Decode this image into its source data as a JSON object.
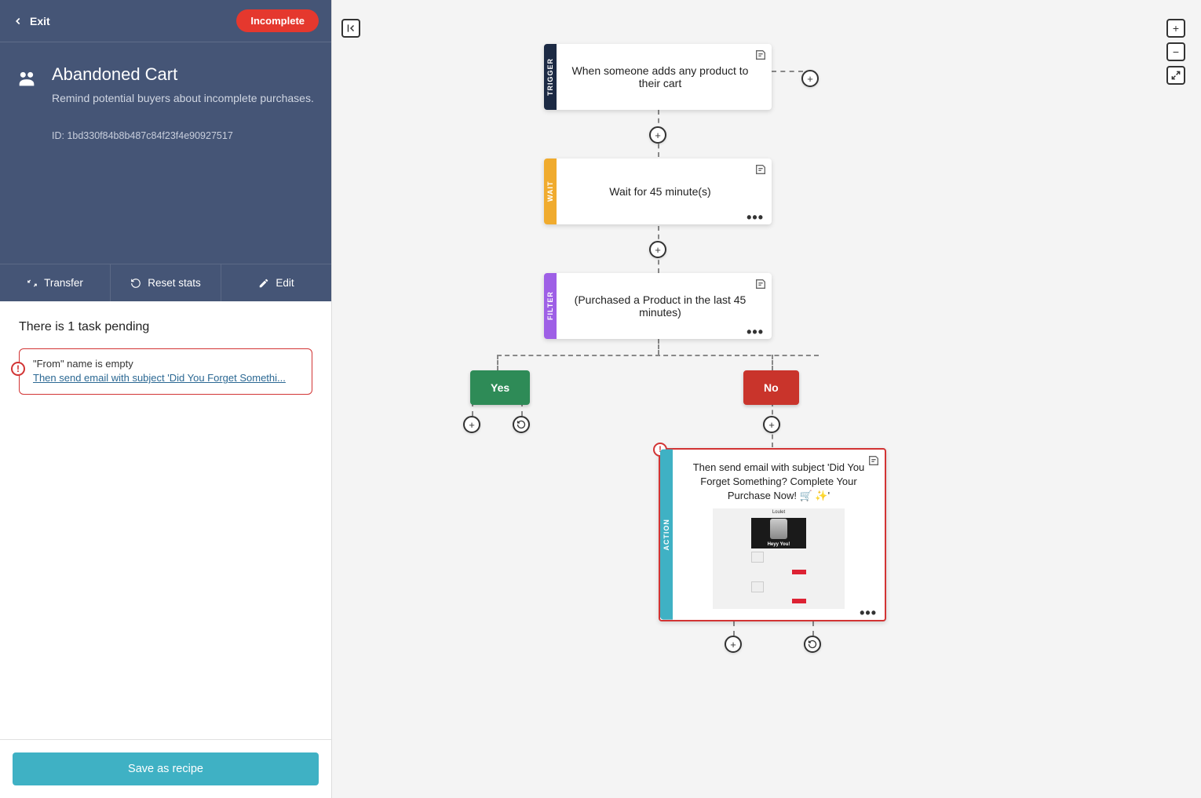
{
  "sidebar": {
    "exit_label": "Exit",
    "status_label": "Incomplete",
    "title": "Abandoned Cart",
    "description": "Remind potential buyers about incomplete purchases.",
    "id_label": "ID: 1bd330f84b8b487c84f23f4e90927517",
    "tabs": {
      "transfer": "Transfer",
      "reset": "Reset stats",
      "edit": "Edit"
    },
    "pending_title": "There is 1 task pending",
    "warning_title": "\"From\" name is empty",
    "warning_link": "Then send email with subject 'Did You Forget Somethi...",
    "recipe_button": "Save as recipe"
  },
  "flow": {
    "trigger": {
      "tag": "TRIGGER",
      "text": "When someone adds any product to their cart"
    },
    "wait": {
      "tag": "WAIT",
      "text": "Wait for 45 minute(s)"
    },
    "filter": {
      "tag": "FILTER",
      "text": "(Purchased a Product in the last 45 minutes)"
    },
    "branches": {
      "yes": "Yes",
      "no": "No"
    },
    "action": {
      "tag": "ACTION",
      "text": "Then send email with subject 'Did You Forget Something? Complete Your Purchase Now! 🛒 ✨'",
      "preview_brand": "Loulet",
      "preview_headline": "Heyy You!"
    }
  }
}
